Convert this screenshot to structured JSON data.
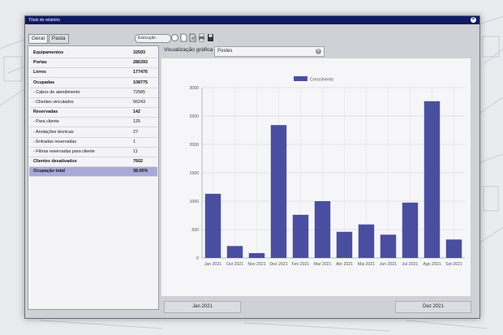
{
  "window": {
    "title": "Título do relatório",
    "close_label": "×"
  },
  "tabs": [
    {
      "label": "Geral"
    },
    {
      "label": "Pasta"
    }
  ],
  "toolbar": {
    "execution_label": "Execução"
  },
  "stats": [
    {
      "label": "Equipamentos",
      "value": "32593",
      "bold": true
    },
    {
      "label": "Portas",
      "value": "286393",
      "bold": true
    },
    {
      "label": "Livres",
      "value": "177476",
      "bold": true
    },
    {
      "label": "Ocupadas",
      "value": "108775",
      "bold": true
    },
    {
      "label": "- Cabos de atendimento",
      "value": "72585",
      "bold": false
    },
    {
      "label": "- Clientes vinculados",
      "value": "56243",
      "bold": false
    },
    {
      "label": "Reservadas",
      "value": "142",
      "bold": true
    },
    {
      "label": "- Para cliente",
      "value": "125",
      "bold": false
    },
    {
      "label": "- Anotações técnicas",
      "value": "27",
      "bold": false
    },
    {
      "label": "- Entradas reservadas",
      "value": "1",
      "bold": false
    },
    {
      "label": "- Fibras reservadas para cliente",
      "value": "11",
      "bold": false
    },
    {
      "label": "Clientes desativados",
      "value": "7602",
      "bold": true
    },
    {
      "label": "Ocupação total",
      "value": "38.00%",
      "bold": true,
      "selected": true
    }
  ],
  "visualization": {
    "label": "Visualização gráfica",
    "selected": "Postes"
  },
  "footer": {
    "start_button": "Jan 2021",
    "end_button": "Dez 2021"
  },
  "chart_data": {
    "type": "bar",
    "categories": [
      "Jan 2021",
      "Out 2021",
      "Nov 2021",
      "Dez 2021",
      "Fev 2021",
      "Mar 2021",
      "Abr 2021",
      "Mai 2021",
      "Jun 2021",
      "Jul 2021",
      "Ago 2021",
      "Set 2021"
    ],
    "series": [
      {
        "name": "Crescimento",
        "values": [
          1130,
          210,
          85,
          2340,
          760,
          1000,
          460,
          590,
          410,
          975,
          2760,
          325
        ],
        "color": "#4a4ea1"
      }
    ],
    "ylim": [
      0,
      3000
    ],
    "yticks": [
      0,
      500,
      1000,
      1500,
      2000,
      2500,
      3000
    ],
    "grid": true,
    "legend": "top-center"
  }
}
